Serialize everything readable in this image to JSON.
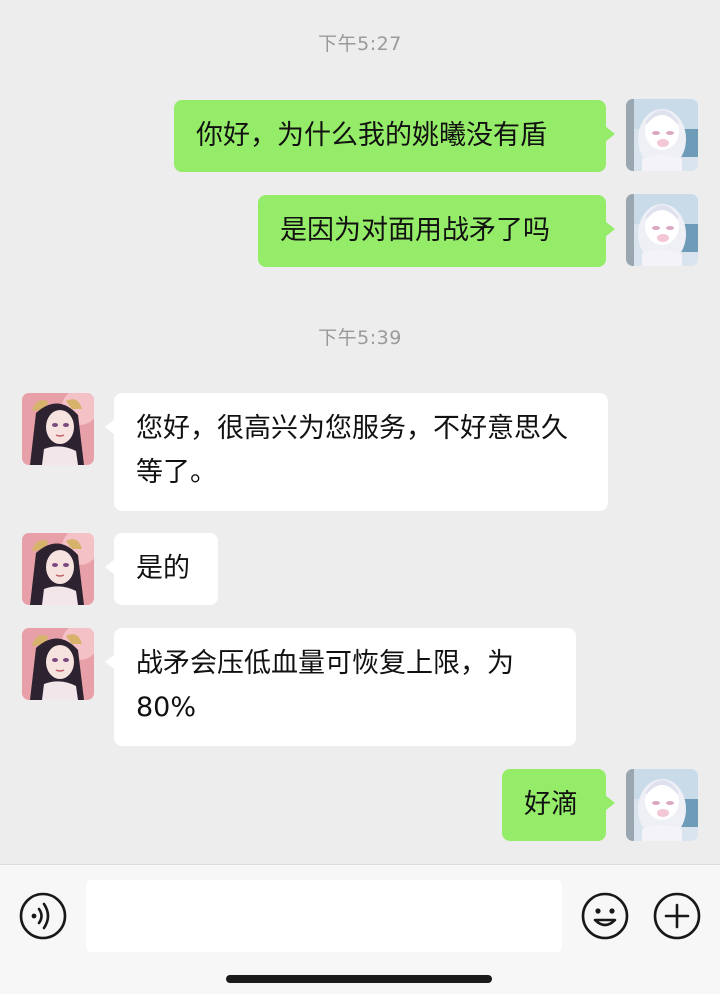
{
  "messages": {
    "time1": "下午5:27",
    "out1": "你好，为什么我的姚曦没有盾",
    "out2": "是因为对面用战矛了吗",
    "time2": "下午5:39",
    "in1": "您好，很高兴为您服务，不好意思久等了。",
    "in2": "是的",
    "in3": "战矛会压低血量可恢复上限，为80%",
    "out3": "好滴"
  },
  "input": {
    "value": "",
    "placeholder": ""
  },
  "icons": {
    "voice": "voice-icon",
    "emoji": "emoji-icon",
    "plus": "plus-icon"
  },
  "colors": {
    "background": "#ededed",
    "bubble_out": "#95ec69",
    "bubble_in": "#ffffff",
    "timestamp": "#9a9a9a"
  }
}
